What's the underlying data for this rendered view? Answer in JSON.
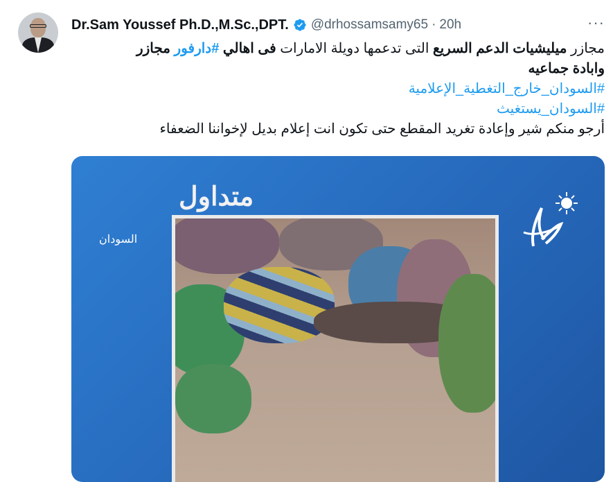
{
  "author": {
    "display_name": "Dr.Sam Youssef Ph.D.,M.Sc.,DPT.",
    "handle": "@drhossamsamy65",
    "separator": "·",
    "time": "20h",
    "verified_icon": "verified-badge-icon"
  },
  "more_label": "···",
  "tweet": {
    "line1_part1": "مجازر ",
    "line1_bold1": "ميليشيات  الدعم السريع",
    "line1_part2": " التى تدعمها دويلة الامارات ",
    "line1_bold2": "فى اهالي",
    "line1_space": " ",
    "line1_hashtag": "#دارفور",
    "line1_part3": " مجازر",
    "line2": "وابادة جماعيه",
    "hashtag1": "#السودان_خارج_التغطية_الإعلامية",
    "hashtag2": "#السودان_يستغيث",
    "line5": "أرجو منكم شير وإعادة تغريد المقطع حتى تكون انت إعلام بديل لإخواننا الضعفاء"
  },
  "media": {
    "label": "متداول",
    "logo_text": "السودان"
  },
  "colors": {
    "link": "#1d9bf0",
    "text": "#0f1419",
    "muted": "#536471",
    "media_bg": "#2566b8"
  }
}
